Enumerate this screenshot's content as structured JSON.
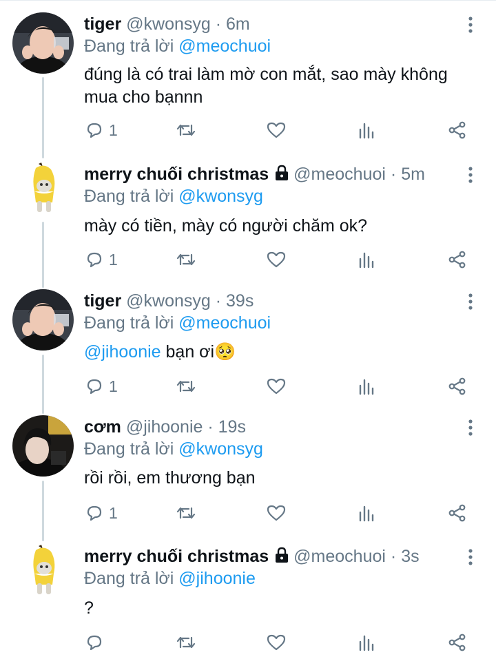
{
  "replying_label": "Đang trả lời",
  "dot": "·",
  "tweets": [
    {
      "name": "tiger",
      "handle": "@kwonsyg",
      "time": "6m",
      "reply_to": "@meochuoi",
      "text": "đúng là có trai làm mờ con mắt, sao mày không mua cho bạnnn",
      "reply_count": "1",
      "avatar": "person-photo"
    },
    {
      "name": "merry chuối christmas",
      "handle": "@meochuoi",
      "time": "5m",
      "reply_to": "@kwonsyg",
      "text": "mày có tiền, mày có người chăm ok?",
      "reply_count": "1",
      "avatar": "banana-cat",
      "protected": true
    },
    {
      "name": "tiger",
      "handle": "@kwonsyg",
      "time": "39s",
      "reply_to": "@meochuoi",
      "text_mention": "@jihoonie",
      "text": " bạn ơi",
      "emoji": "🥺",
      "reply_count": "1",
      "avatar": "person-photo"
    },
    {
      "name": "cơm",
      "handle": "@jihoonie",
      "time": "19s",
      "reply_to": "@kwonsyg",
      "text": "rồi rồi, em thương bạn",
      "reply_count": "1",
      "avatar": "person-photo-dark"
    },
    {
      "name": "merry chuối christmas",
      "handle": "@meochuoi",
      "time": "3s",
      "reply_to": "@jihoonie",
      "text": "?",
      "reply_count": "",
      "avatar": "banana-cat",
      "protected": true
    }
  ],
  "colors": {
    "accent": "#1d9bf0",
    "muted": "#657786",
    "thread_line": "#cfd9de"
  },
  "icons": [
    "reply-icon",
    "retweet-icon",
    "like-icon",
    "analytics-icon",
    "share-icon",
    "more-icon",
    "lock-icon"
  ]
}
